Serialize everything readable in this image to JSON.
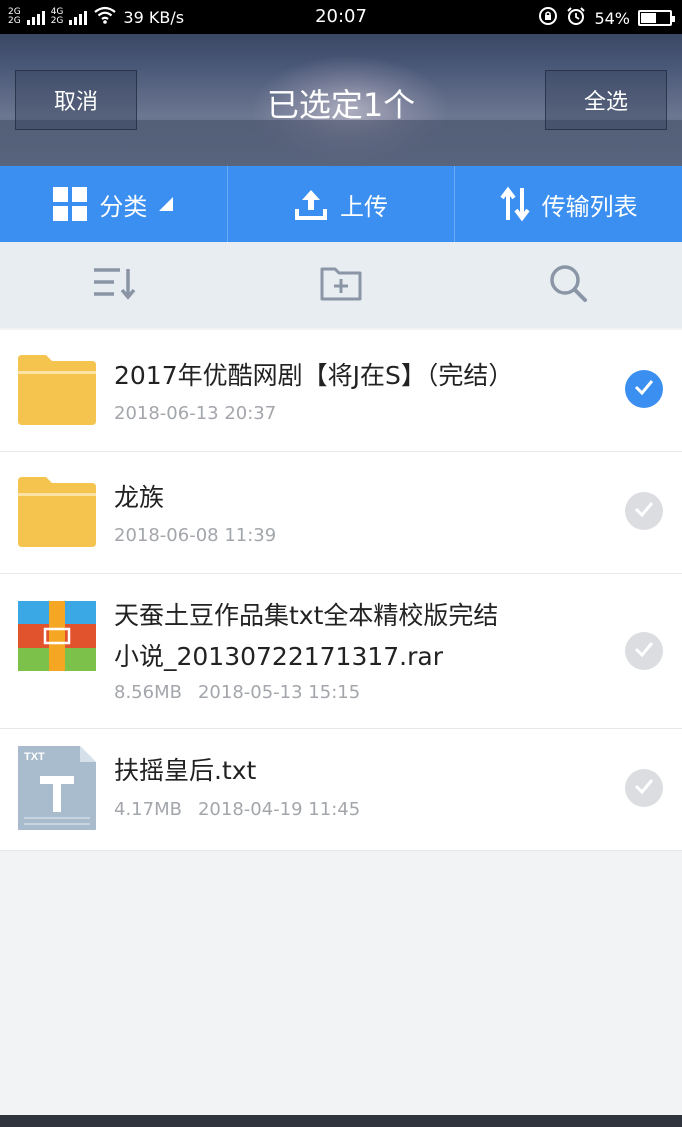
{
  "status_bar": {
    "network_top": "2G",
    "network_4g": "4G",
    "network_bottom": "2G",
    "speed": "39 KB/s",
    "time": "20:07",
    "battery": "54%",
    "battery_level": 0.54
  },
  "header": {
    "cancel_label": "取消",
    "title": "已选定1个",
    "select_all_label": "全选"
  },
  "actions": {
    "category_label": "分类",
    "upload_label": "上传",
    "transfer_label": "传输列表"
  },
  "colors": {
    "accent": "#3a8ff0",
    "folder": "#f4c44e"
  },
  "files": [
    {
      "name": "2017年优酷网剧【将J在S】（完结）",
      "size": "",
      "date": "2018-06-13  20:37",
      "type_icon": "folder-icon",
      "selected": true
    },
    {
      "name": "龙族",
      "size": "",
      "date": "2018-06-08  11:39",
      "type_icon": "folder-icon",
      "selected": false
    },
    {
      "name_line1": "天蚕土豆作品集txt全本精校版完结",
      "name_line2": "小说_20130722171317.rar",
      "size": "8.56MB",
      "date": "2018-05-13  15:15",
      "type_icon": "archive-icon",
      "selected": false
    },
    {
      "name": "扶摇皇后.txt",
      "size": "4.17MB",
      "date": "2018-04-19  11:45",
      "type_icon": "txt-file-icon",
      "type_label": "TXT",
      "selected": false
    }
  ]
}
